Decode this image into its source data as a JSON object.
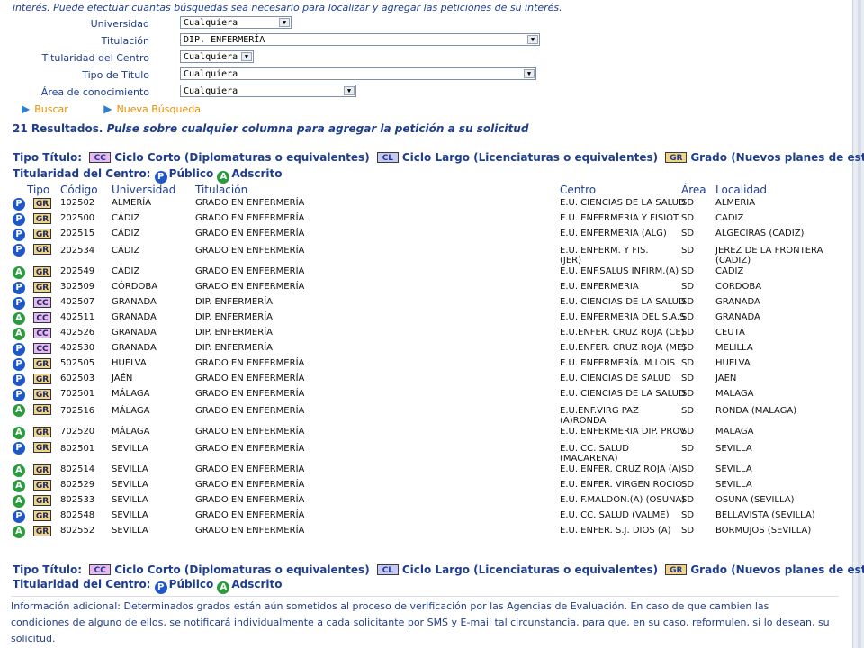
{
  "top_note": "interés. Puede efectuar cuantas búsquedas sea necesario para localizar y agregar las peticiones de su interés.",
  "filters": [
    {
      "label": "Universidad",
      "value": "Cualquiera",
      "width": 124
    },
    {
      "label": "Titulación",
      "value": "DIP. ENFERMERÍA",
      "width": 400
    },
    {
      "label": "Titularidad del Centro",
      "value": "Cualquiera",
      "width": 82
    },
    {
      "label": "Tipo de Título",
      "value": "Cualquiera",
      "width": 396
    },
    {
      "label": "Área de conocimiento",
      "value": "Cualquiera",
      "width": 196
    }
  ],
  "actions": {
    "search": "Buscar",
    "new_search": "Nueva Búsqueda"
  },
  "results_count": "21 Resultados.",
  "results_instruction": "Pulse sobre cualquier columna para agregar la petición a su solicitud",
  "legend": {
    "tipo_titulo_label": "Tipo Título:",
    "cc_badge": "CC",
    "cc_text": "Ciclo Corto (Diplomaturas o equivalentes)",
    "cl_badge": "CL",
    "cl_text": "Ciclo Largo (Licenciaturas o equivalentes)",
    "gr_badge": "GR",
    "gr_text": "Grado (Nuevos planes de estudios)",
    "titularidad_label": "Titularidad del Centro:",
    "p_icon": "P",
    "p_text": "Público",
    "a_icon": "A",
    "a_text": "Adscrito"
  },
  "table": {
    "headers": [
      "Tipo",
      "Código",
      "Universidad",
      "Titulación",
      "Centro",
      "Área",
      "Localidad"
    ],
    "rows": [
      {
        "tit": "P",
        "type": "GR",
        "code": "102502",
        "univ": "ALMERÍA",
        "titulacion": "GRADO EN ENFERMERÍA",
        "centro": "E.U. CIENCIAS DE LA SALUD",
        "area": "SD",
        "localidad": "ALMERIA"
      },
      {
        "tit": "P",
        "type": "GR",
        "code": "202500",
        "univ": "CÁDIZ",
        "titulacion": "GRADO EN ENFERMERÍA",
        "centro": "E.U. ENFERMERIA Y FISIOT.",
        "area": "SD",
        "localidad": "CADIZ"
      },
      {
        "tit": "P",
        "type": "GR",
        "code": "202515",
        "univ": "CÁDIZ",
        "titulacion": "GRADO EN ENFERMERÍA",
        "centro": "E.U. ENFERMERIA (ALG)",
        "area": "SD",
        "localidad": "ALGECIRAS (CADIZ)"
      },
      {
        "tit": "P",
        "type": "GR",
        "code": "202534",
        "univ": "CÁDIZ",
        "titulacion": "GRADO EN ENFERMERÍA",
        "centro": "E.U. ENFERM. Y FIS. (JER)",
        "area": "SD",
        "localidad": "JEREZ DE LA FRONTERA (CADIZ)",
        "tall": "taller"
      },
      {
        "tit": "A",
        "type": "GR",
        "code": "202549",
        "univ": "CÁDIZ",
        "titulacion": "GRADO EN ENFERMERÍA",
        "centro": "E.U. ENF.SALUS INFIRM.(A)",
        "area": "SD",
        "localidad": "CADIZ"
      },
      {
        "tit": "P",
        "type": "GR",
        "code": "302509",
        "univ": "CÓRDOBA",
        "titulacion": "GRADO EN ENFERMERÍA",
        "centro": "E.U. ENFERMERIA",
        "area": "SD",
        "localidad": "CORDOBA"
      },
      {
        "tit": "P",
        "type": "CC",
        "code": "402507",
        "univ": "GRANADA",
        "titulacion": "DIP. ENFERMERÍA",
        "centro": "E.U. CIENCIAS DE LA SALUD",
        "area": "SD",
        "localidad": "GRANADA"
      },
      {
        "tit": "A",
        "type": "CC",
        "code": "402511",
        "univ": "GRANADA",
        "titulacion": "DIP. ENFERMERÍA",
        "centro": "E.U. ENFERMERIA DEL S.A.S",
        "area": "SD",
        "localidad": "GRANADA"
      },
      {
        "tit": "A",
        "type": "CC",
        "code": "402526",
        "univ": "GRANADA",
        "titulacion": "DIP. ENFERMERÍA",
        "centro": "E.U.ENFER. CRUZ ROJA (CE)",
        "area": "SD",
        "localidad": "CEUTA"
      },
      {
        "tit": "P",
        "type": "CC",
        "code": "402530",
        "univ": "GRANADA",
        "titulacion": "DIP. ENFERMERÍA",
        "centro": "E.U.ENFER. CRUZ ROJA (ME)",
        "area": "SD",
        "localidad": "MELILLA"
      },
      {
        "tit": "P",
        "type": "GR",
        "code": "502505",
        "univ": "HUELVA",
        "titulacion": "GRADO EN ENFERMERÍA",
        "centro": "E.U. ENFERMERÍA. M.LOIS",
        "area": "SD",
        "localidad": "HUELVA"
      },
      {
        "tit": "P",
        "type": "GR",
        "code": "602503",
        "univ": "JAÉN",
        "titulacion": "GRADO EN ENFERMERÍA",
        "centro": "E.U. CIENCIAS DE SALUD",
        "area": "SD",
        "localidad": "JAEN"
      },
      {
        "tit": "P",
        "type": "GR",
        "code": "702501",
        "univ": "MÁLAGA",
        "titulacion": "GRADO EN ENFERMERÍA",
        "centro": "E.U. CIENCIAS DE LA SALUD",
        "area": "SD",
        "localidad": "MALAGA"
      },
      {
        "tit": "A",
        "type": "GR",
        "code": "702516",
        "univ": "MÁLAGA",
        "titulacion": "GRADO EN ENFERMERÍA",
        "centro": "E.U.ENF.VIRG PAZ (A)RONDA",
        "area": "SD",
        "localidad": "RONDA (MALAGA)",
        "tall": "taller"
      },
      {
        "tit": "A",
        "type": "GR",
        "code": "702520",
        "univ": "MÁLAGA",
        "titulacion": "GRADO EN ENFERMERÍA",
        "centro": "E.U. ENFERMERIA DIP. PROV",
        "area": "SD",
        "localidad": "MALAGA"
      },
      {
        "tit": "P",
        "type": "GR",
        "code": "802501",
        "univ": "SEVILLA",
        "titulacion": "GRADO EN ENFERMERÍA",
        "centro": "E.U. CC. SALUD (MACARENA)",
        "area": "SD",
        "localidad": "SEVILLA",
        "tall": "taller"
      },
      {
        "tit": "A",
        "type": "GR",
        "code": "802514",
        "univ": "SEVILLA",
        "titulacion": "GRADO EN ENFERMERÍA",
        "centro": "E.U. ENFER. CRUZ ROJA (A)",
        "area": "SD",
        "localidad": "SEVILLA"
      },
      {
        "tit": "A",
        "type": "GR",
        "code": "802529",
        "univ": "SEVILLA",
        "titulacion": "GRADO EN ENFERMERÍA",
        "centro": "E.U. ENFER. VIRGEN ROCIO",
        "area": "SD",
        "localidad": "SEVILLA"
      },
      {
        "tit": "A",
        "type": "GR",
        "code": "802533",
        "univ": "SEVILLA",
        "titulacion": "GRADO EN ENFERMERÍA",
        "centro": "E.U. F.MALDON.(A) (OSUNA)",
        "area": "SD",
        "localidad": "OSUNA (SEVILLA)"
      },
      {
        "tit": "P",
        "type": "GR",
        "code": "802548",
        "univ": "SEVILLA",
        "titulacion": "GRADO EN ENFERMERÍA",
        "centro": "E.U. CC. SALUD (VALME)",
        "area": "SD",
        "localidad": "BELLAVISTA (SEVILLA)"
      },
      {
        "tit": "A",
        "type": "GR",
        "code": "802552",
        "univ": "SEVILLA",
        "titulacion": "GRADO EN ENFERMERÍA",
        "centro": "E.U. ENFER. S.J. DIOS (A)",
        "area": "SD",
        "localidad": "BORMUJOS (SEVILLA)"
      }
    ]
  },
  "footer_note": "Información adicional: Determinados grados están aún sometidos al proceso de verificación por las Agencias de Evaluación. En caso de que cambien las condiciones de alguno de ellos, se notificará individualmente a cada solicitante por SMS y E-mail tal circunstancia, para que, en su caso, reformulen, si lo desean, su solicitud."
}
